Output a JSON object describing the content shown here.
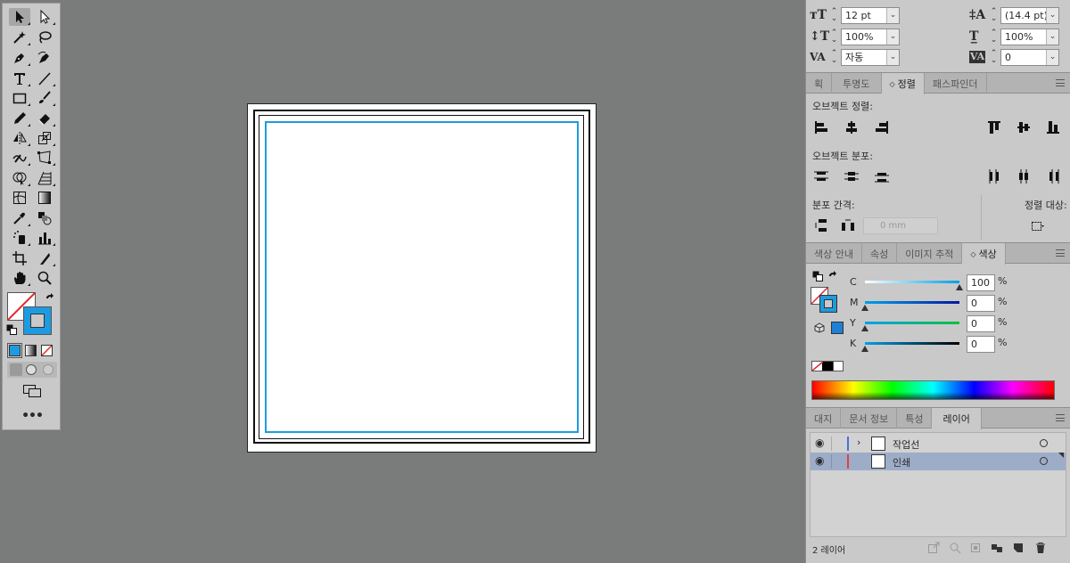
{
  "colors": {
    "accent_blue": "#1e9be0",
    "canvas_bg": "#7a7b7b",
    "panel_bg": "#c9c9c9",
    "layer_selected": "#9dadc8"
  },
  "toolbar": {
    "tools": [
      "selection-tool-icon",
      "direct-selection-tool-icon",
      "magic-wand-icon",
      "lasso-icon",
      "pen-tool-icon",
      "curvature-icon",
      "type-tool-icon",
      "line-tool-icon",
      "rectangle-tool-icon",
      "paintbrush-icon",
      "pencil-icon",
      "eraser-icon",
      "reflect-icon",
      "scale-icon",
      "warp-icon",
      "free-transform-icon",
      "shape-builder-icon",
      "perspective-grid-icon",
      "mesh-icon",
      "gradient-icon",
      "eyedropper-icon",
      "blend-icon",
      "symbol-sprayer-icon",
      "column-graph-icon",
      "artboard-tool-icon",
      "slice-icon",
      "hand-tool-icon",
      "zoom-tool-icon"
    ],
    "more_label": "•••"
  },
  "character": {
    "font_size": "12 pt",
    "leading": "(14.4 pt)",
    "vertical_scale": "100%",
    "horizontal_scale": "100%",
    "kerning": "자동",
    "tracking": "0"
  },
  "align_tabs": [
    "획",
    "투명도",
    "정렬",
    "패스파인더"
  ],
  "align_active_tab": "정렬",
  "align": {
    "object_align_label": "오브젝트 정렬:",
    "object_distribute_label": "오브젝트 분포:",
    "distribute_spacing_label": "분포 간격:",
    "align_to_label": "정렬 대상:",
    "spacing_value": "0 mm"
  },
  "color_tabs": [
    "색상 안내",
    "속성",
    "이미지 추적",
    "색상"
  ],
  "color_active_tab": "색상",
  "color": {
    "channels": [
      {
        "name": "C",
        "value": "100",
        "level": 1.0,
        "gradient": [
          "#ffffff",
          "#00a0e9"
        ]
      },
      {
        "name": "M",
        "value": "0",
        "level": 0.0,
        "gradient": [
          "#00a0e9",
          "#0018a0"
        ]
      },
      {
        "name": "Y",
        "value": "0",
        "level": 0.0,
        "gradient": [
          "#00a0e9",
          "#00c040"
        ]
      },
      {
        "name": "K",
        "value": "0",
        "level": 0.0,
        "gradient": [
          "#00a0e9",
          "#000000"
        ]
      }
    ],
    "unit": "%"
  },
  "layers_tabs": [
    "대지",
    "문서 정보",
    "특성",
    "레이어"
  ],
  "layers_active_tab": "레이어",
  "layers": [
    {
      "name": "작업선",
      "color": "#4b6ee0",
      "selected": false,
      "expandable": true
    },
    {
      "name": "인쇄",
      "color": "#e04040",
      "selected": true,
      "expandable": false
    }
  ],
  "layers_footer": "2 레이어"
}
